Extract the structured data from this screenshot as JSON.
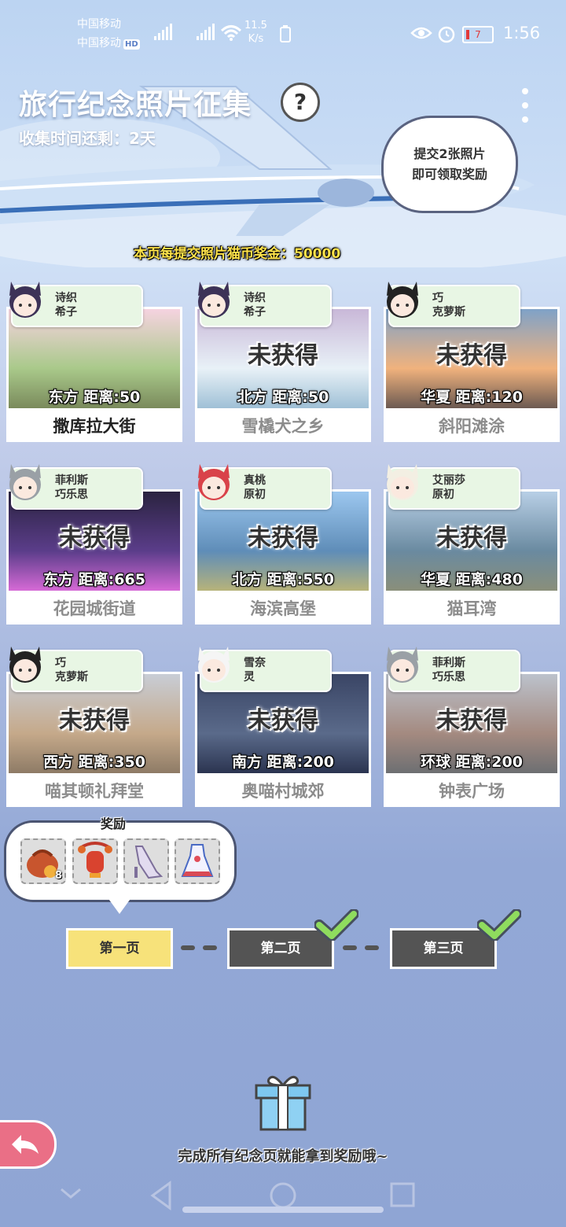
{
  "status_bar": {
    "carrier1": "中国移动",
    "carrier2": "中国移动",
    "hd": "HD",
    "net_speed": "11.5",
    "net_unit": "K/s",
    "battery": "7",
    "time": "1:56"
  },
  "header": {
    "title": "旅行纪念照片征集",
    "subtitle": "收集时间还剩：2天",
    "help_label": "?",
    "bubble_line1": "提交2张照片",
    "bubble_line2": "即可领取奖励",
    "bonus_text": "本页每提交照片猫币奖金：50000"
  },
  "cards": [
    {
      "character": [
        "诗织",
        "希子"
      ],
      "status": "",
      "direction": "东方  距离:50",
      "place": "撒库拉大街",
      "collected": true
    },
    {
      "character": [
        "诗织",
        "希子"
      ],
      "status": "未获得",
      "direction": "北方  距离:50",
      "place": "雪橇犬之乡",
      "collected": false
    },
    {
      "character": [
        "巧",
        "克萝斯"
      ],
      "status": "未获得",
      "direction": "华夏  距离:120",
      "place": "斜阳滩涂",
      "collected": false
    },
    {
      "character": [
        "菲利斯",
        "巧乐思"
      ],
      "status": "未获得",
      "direction": "东方  距离:665",
      "place": "花园城街道",
      "collected": false
    },
    {
      "character": [
        "真桃",
        "原初"
      ],
      "status": "未获得",
      "direction": "北方  距离:550",
      "place": "海滨高堡",
      "collected": false
    },
    {
      "character": [
        "艾丽莎",
        "原初"
      ],
      "status": "未获得",
      "direction": "华夏  距离:480",
      "place": "猫耳湾",
      "collected": false
    },
    {
      "character": [
        "巧",
        "克萝斯"
      ],
      "status": "未获得",
      "direction": "西方  距离:350",
      "place": "喵其顿礼拜堂",
      "collected": false
    },
    {
      "character": [
        "雪奈",
        "灵"
      ],
      "status": "未获得",
      "direction": "南方  距离:200",
      "place": "奥喵村城郊",
      "collected": false
    },
    {
      "character": [
        "菲利斯",
        "巧乐思"
      ],
      "status": "未获得",
      "direction": "环球  距离:200",
      "place": "钟表广场",
      "collected": false
    }
  ],
  "rewards": {
    "label": "奖励",
    "items": [
      {
        "icon": "coin-bag-icon",
        "count": "8"
      },
      {
        "icon": "red-lantern-icon",
        "count": ""
      },
      {
        "icon": "high-heel-shoe-icon",
        "count": ""
      },
      {
        "icon": "dress-icon",
        "count": ""
      }
    ]
  },
  "pager": {
    "pages": [
      {
        "label": "第一页",
        "state": "active",
        "completed": false
      },
      {
        "label": "第二页",
        "state": "done",
        "completed": true
      },
      {
        "label": "第三页",
        "state": "done",
        "completed": true
      }
    ]
  },
  "footer": {
    "text": "完成所有纪念页就能拿到奖励哦~"
  },
  "colors": {
    "active_page": "#f7e27a",
    "inactive_page": "#545454",
    "check": "#8fdc5e",
    "bonus": "#ffe34a",
    "back_button": "#ea6f86"
  }
}
